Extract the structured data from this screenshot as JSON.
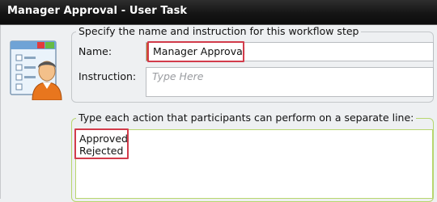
{
  "window": {
    "title": "Manager Approval - User Task"
  },
  "step_group": {
    "legend": "Specify the name and instruction for this workflow step",
    "name_label": "Name:",
    "name_value": "Manager Approval",
    "instruction_label": "Instruction:",
    "instruction_placeholder": "Type Here"
  },
  "actions_group": {
    "legend": "Type each action that participants can perform on a separate line:",
    "lines": [
      "Approved",
      "Rejected"
    ]
  },
  "icons": {
    "task": "user-task-icon"
  },
  "colors": {
    "highlight": "#d23c4b",
    "active_border": "#b7d66e",
    "titlebar": "#151515"
  }
}
